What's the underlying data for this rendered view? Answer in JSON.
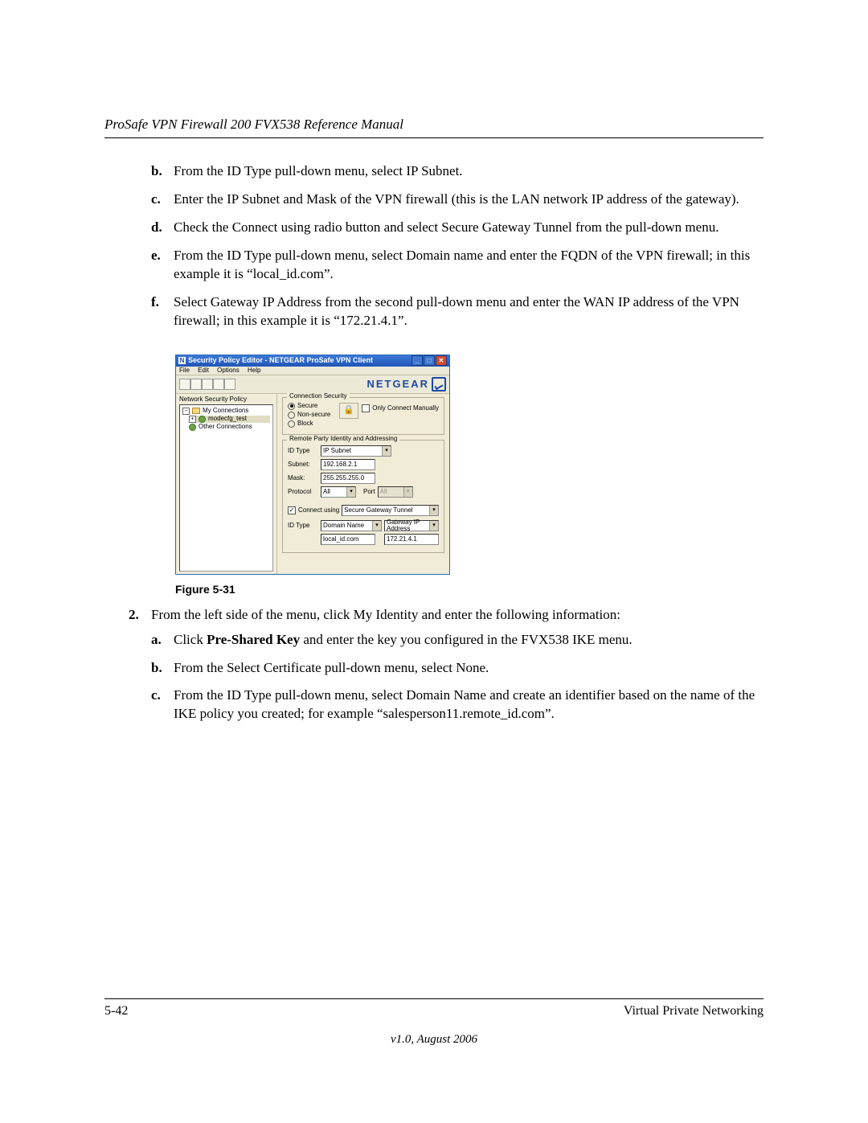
{
  "header": {
    "title": "ProSafe VPN Firewall 200 FVX538 Reference Manual"
  },
  "steps_top": [
    {
      "marker": "b.",
      "text": "From the ID Type pull-down menu, select IP Subnet."
    },
    {
      "marker": "c.",
      "text": "Enter the IP Subnet and Mask of the VPN firewall (this is the LAN network IP address of the gateway)."
    },
    {
      "marker": "d.",
      "text": "Check the Connect using radio button and select Secure Gateway Tunnel from the pull-down menu."
    },
    {
      "marker": "e.",
      "text": "From the ID Type pull-down menu, select Domain name and enter the FQDN of the VPN firewall; in this example it is “local_id.com”."
    },
    {
      "marker": "f.",
      "text": "Select Gateway IP Address from the second pull-down menu and enter the WAN IP address of the VPN firewall; in this example it is “172.21.4.1”."
    }
  ],
  "figure_caption": "Figure 5-31",
  "step2": {
    "marker": "2.",
    "text": "From the left side of the menu, click My Identity and enter the following information:",
    "sub": [
      {
        "marker": "a.",
        "pre": "Click ",
        "bold": "Pre-Shared Key",
        "post": " and enter the key you configured in the FVX538 IKE menu."
      },
      {
        "marker": "b.",
        "text": "From the Select Certificate pull-down menu, select None."
      },
      {
        "marker": "c.",
        "text": "From the ID Type pull-down menu, select Domain Name and create an identifier based on the name of the IKE policy you created; for example “salesperson11.remote_id.com”."
      }
    ]
  },
  "footer": {
    "page": "5-42",
    "section": "Virtual Private Networking",
    "version": "v1.0, August 2006"
  },
  "win": {
    "title": "Security Policy Editor - NETGEAR ProSafe VPN Client",
    "menu": {
      "file": "File",
      "edit": "Edit",
      "options": "Options",
      "help": "Help"
    },
    "brand": "NETGEAR",
    "tree_label": "Network Security Policy",
    "tree": {
      "root": "My Connections",
      "item1": "modecfg_test",
      "item2": "Other Connections"
    },
    "conn_sec": {
      "title": "Connection Security",
      "secure": "Secure",
      "nonsecure": "Non-secure",
      "block": "Block",
      "only_manual": "Only Connect Manually"
    },
    "remote": {
      "title": "Remote Party Identity and Addressing",
      "idtype_lbl": "ID Type",
      "idtype_val": "IP Subnet",
      "subnet_lbl": "Subnet:",
      "subnet_val": "192.168.2.1",
      "mask_lbl": "Mask:",
      "mask_val": "255.255.255.0",
      "proto_lbl": "Protocol",
      "proto_val": "All",
      "port_lbl": "Port",
      "port_val": "All",
      "connect_using_lbl": "Connect using",
      "connect_using_val": "Secure Gateway Tunnel",
      "idtype2_lbl": "ID Type",
      "idtype2_val": "Domain Name",
      "gw_sel": "Gateway IP Address",
      "domain_val": "local_id.com",
      "gwip_val": "172.21.4.1"
    }
  }
}
